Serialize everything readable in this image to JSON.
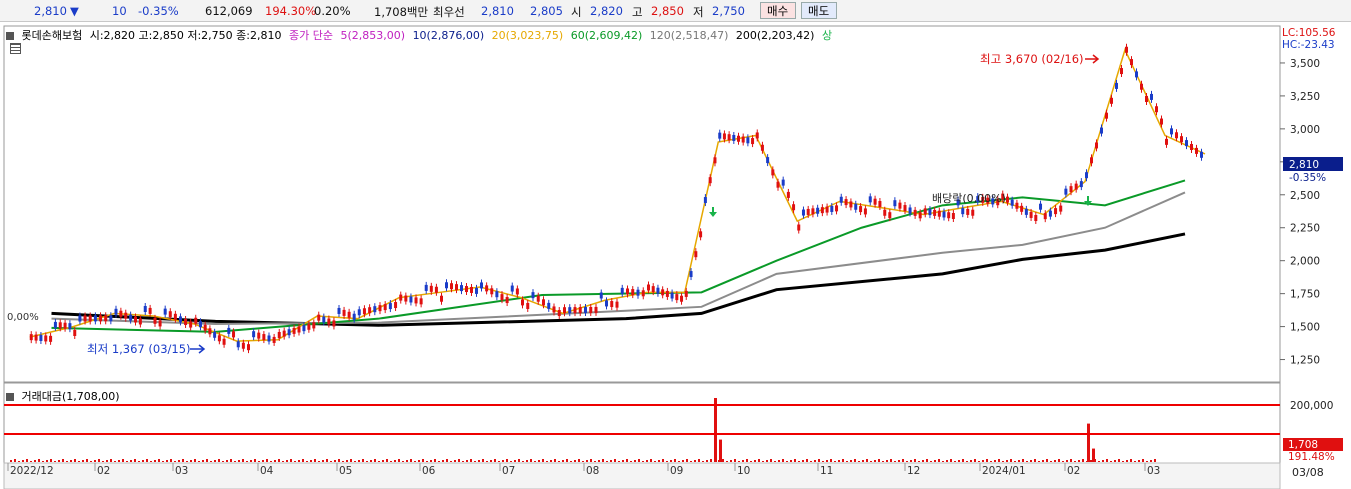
{
  "topbar": {
    "price": "2,810",
    "change": "10",
    "change_pct": "-0.35%",
    "volume": "612,069",
    "vol_ratio": "194.30%",
    "turnover_pct": "0.20%",
    "amount": "1,708백만",
    "bid_label": "최우선",
    "ask_price": "2,810",
    "bid_price": "2,805",
    "open_label": "시",
    "open": "2,820",
    "high_label": "고",
    "high": "2,850",
    "low_label": "저",
    "low": "2,750",
    "buy_label": "매수",
    "sell_label": "매도"
  },
  "legend": {
    "stock": "롯데손해보험",
    "ohlc": "시:2,820 고:2,850 저:2,750 종:2,810",
    "ma_label": "종가 단순",
    "ma5": "5(2,853,00)",
    "ma10": "10(2,876,00)",
    "ma20": "20(3,023,75)",
    "ma60": "60(2,609,42)",
    "ma120": "120(2,518,47)",
    "ma200": "200(2,203,42)",
    "up_label": "상"
  },
  "right_info": {
    "lc": "LC:105.56",
    "hc": "HC:-23.43"
  },
  "annotations": {
    "high": "최고 3,670 (02/16)",
    "low": "최저 1,367 (03/15)",
    "dividend": "배당락(0,00%)",
    "left_pct": "0,00%",
    "current_price_tag": "2,810",
    "current_pct_tag": "-0.35%"
  },
  "volume_panel": {
    "title": "거래대금(1,708,00)",
    "tick_top": "200,000",
    "current_tag": "1,708",
    "pct_tag": "191.48%"
  },
  "date_end_label": "03/08",
  "chart_data": {
    "type": "candlestick",
    "title": "롯데손해보험",
    "y_ticks": [
      1250,
      1500,
      1750,
      2000,
      2250,
      2500,
      2750,
      3000,
      3250,
      3500
    ],
    "y_tick_labels": [
      "1,250",
      "1,500",
      "1,750",
      "2,000",
      "2,250",
      "2,500",
      "2,750",
      "3,000",
      "3,250",
      "3,500"
    ],
    "ylim": [
      1110,
      3750
    ],
    "x_labels": [
      "2022/12",
      "02",
      "03",
      "04",
      "05",
      "06",
      "07",
      "08",
      "09",
      "10",
      "11",
      "12",
      "2024/01",
      "02",
      "03"
    ],
    "close_path": [
      [
        "2022/12",
        1420
      ],
      [
        "2022/12",
        1500
      ],
      [
        "02",
        1600
      ],
      [
        "02",
        1580
      ],
      [
        "03",
        1520
      ],
      [
        "03",
        1390
      ],
      [
        "04",
        1400
      ],
      [
        "04",
        1580
      ],
      [
        "05",
        1560
      ],
      [
        "05",
        1720
      ],
      [
        "06",
        1760
      ],
      [
        "06",
        1800
      ],
      [
        "07",
        1720
      ],
      [
        "07",
        1600
      ],
      [
        "08",
        1700
      ],
      [
        "08",
        1760
      ],
      [
        "09",
        1760
      ],
      [
        "09",
        2900
      ],
      [
        "10",
        2950
      ],
      [
        "10",
        2300
      ],
      [
        "11",
        2450
      ],
      [
        "11",
        2400
      ],
      [
        "12",
        2350
      ],
      [
        "12",
        2400
      ],
      [
        "2024/01",
        2450
      ],
      [
        "2024/01",
        2350
      ],
      [
        "02",
        2600
      ],
      [
        "02",
        3600
      ],
      [
        "03",
        2950
      ],
      [
        "03",
        2810
      ]
    ],
    "series": [
      {
        "name": "5",
        "color": "#c020c0"
      },
      {
        "name": "10",
        "color": "#0a1e8c"
      },
      {
        "name": "20",
        "color": "#e6a800"
      },
      {
        "name": "60",
        "color": "#0a9a28"
      },
      {
        "name": "120",
        "color": "#8c8c8c"
      },
      {
        "name": "200",
        "color": "#000000"
      }
    ],
    "ma200_path": [
      [
        "2022/12",
        1600
      ],
      [
        "03",
        1540
      ],
      [
        "05",
        1510
      ],
      [
        "08",
        1560
      ],
      [
        "09",
        1600
      ],
      [
        "10",
        1780
      ],
      [
        "12",
        1900
      ],
      [
        "2024/01",
        2010
      ],
      [
        "02",
        2080
      ],
      [
        "03",
        2203
      ]
    ],
    "ma120_path": [
      [
        "2022/12",
        1560
      ],
      [
        "03",
        1520
      ],
      [
        "05",
        1530
      ],
      [
        "08",
        1620
      ],
      [
        "09",
        1650
      ],
      [
        "10",
        1900
      ],
      [
        "12",
        2060
      ],
      [
        "2024/01",
        2120
      ],
      [
        "02",
        2250
      ],
      [
        "03",
        2518
      ]
    ],
    "ma60_path": [
      [
        "2022/12",
        1490
      ],
      [
        "03",
        1460
      ],
      [
        "05",
        1560
      ],
      [
        "07",
        1740
      ],
      [
        "09",
        1760
      ],
      [
        "10",
        2000
      ],
      [
        "11",
        2250
      ],
      [
        "12",
        2420
      ],
      [
        "2024/01",
        2480
      ],
      [
        "02",
        2420
      ],
      [
        "03",
        2609
      ]
    ],
    "volume_ticks": [
      "200,000"
    ],
    "volume_spikes": [
      [
        "09",
        200000
      ],
      [
        "02",
        120000
      ]
    ]
  }
}
